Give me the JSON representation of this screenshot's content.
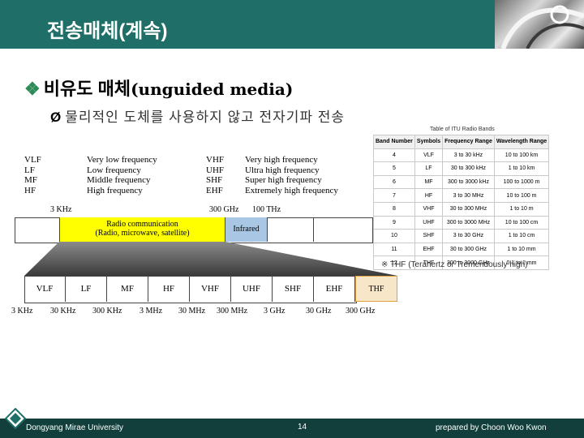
{
  "header": {
    "title": "전송매체(계속)"
  },
  "content": {
    "bullet1_mark": "❖",
    "bullet1_kr": "비유도 매체",
    "bullet1_en": "(unguided media)",
    "bullet2_arrow": "Ø",
    "bullet2_text": "물리적인 도체를 사용하지 않고 전자기파 전송"
  },
  "spectrum": {
    "left_abbr": [
      "VLF",
      "LF",
      "MF",
      "HF"
    ],
    "left_names": [
      "Very low frequency",
      "Low frequency",
      "Middle frequency",
      "High frequency"
    ],
    "right_abbr": [
      "VHF",
      "UHF",
      "SHF",
      "EHF"
    ],
    "right_names": [
      "Very high frequency",
      "Ultra high frequency",
      "Super high frequency",
      "Extremely high frequency"
    ],
    "upper_labels": [
      "3 KHz",
      "300 GHz",
      "100 THz"
    ],
    "radio_line1": "Radio communication",
    "radio_line2": "(Radio, microwave, satellite)",
    "infrared": "Infrared",
    "lower_bands": [
      "VLF",
      "LF",
      "MF",
      "HF",
      "VHF",
      "UHF",
      "SHF",
      "EHF"
    ],
    "thf_box": "THF",
    "lower_labels": [
      "3 KHz",
      "30 KHz",
      "300 KHz",
      "3 MHz",
      "30 MHz",
      "300 MHz",
      "3 GHz",
      "30 GHz",
      "300 GHz"
    ]
  },
  "itu_table": {
    "caption": "Table of ITU Radio Bands",
    "headers": [
      "Band Number",
      "Symbols",
      "Frequency Range",
      "Wavelength Range"
    ],
    "rows": [
      [
        "4",
        "VLF",
        "3 to 30 kHz",
        "10 to 100 km"
      ],
      [
        "5",
        "LF",
        "30 to 300 kHz",
        "1 to 10 km"
      ],
      [
        "6",
        "MF",
        "300 to 3000 kHz",
        "100 to 1000 m"
      ],
      [
        "7",
        "HF",
        "3 to 30 MHz",
        "10 to 100 m"
      ],
      [
        "8",
        "VHF",
        "30 to 300 MHz",
        "1 to 10 m"
      ],
      [
        "9",
        "UHF",
        "300 to 3000 MHz",
        "10 to 100 cm"
      ],
      [
        "10",
        "SHF",
        "3 to 30 GHz",
        "1 to 10 cm"
      ],
      [
        "11",
        "EHF",
        "30 to 300 GHz",
        "1 to 10 mm"
      ],
      [
        "12",
        "THF",
        "300 to 3000 GHz",
        "0.1 to 1 mm"
      ]
    ]
  },
  "thf_note": "※ THF (Terahertz or Tremendously high)",
  "footer": {
    "university": "Dongyang Mirae University",
    "page": "14",
    "author": "prepared by Choon Woo Kwon"
  },
  "colors": {
    "header_bg": "#1f6f68",
    "footer_bg": "#123f3c",
    "radio_band": "#ffff00",
    "infrared_band": "#a9c7e4"
  }
}
